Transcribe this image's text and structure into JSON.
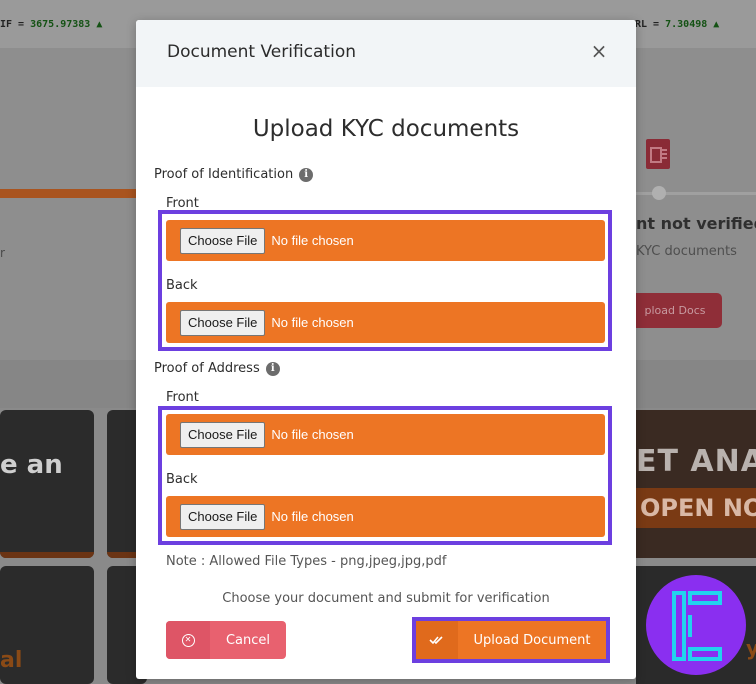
{
  "ticker": [
    {
      "label": "IF = ",
      "value": "3675.97383 ▲"
    },
    {
      "label": "RL = ",
      "value": "7.30498 ▲"
    }
  ],
  "background": {
    "status_title": "nt not verified",
    "status_sub": "KYC documents",
    "upload_docs_label": "pload Docs",
    "left_text": "r",
    "card1_text": "e an",
    "card3_text": "al",
    "banner_line1": "ET ANA",
    "banner_line2": "OPEN NOW",
    "banner2_text": "ys"
  },
  "modal": {
    "title": "Document Verification",
    "close_glyph": "×",
    "heading": "Upload KYC documents",
    "sections": [
      {
        "label": "Proof of Identification",
        "fields": [
          {
            "label": "Front",
            "button": "Choose File",
            "status": "No file chosen"
          },
          {
            "label": "Back",
            "button": "Choose File",
            "status": "No file chosen"
          }
        ]
      },
      {
        "label": "Proof of Address",
        "fields": [
          {
            "label": "Front",
            "button": "Choose File",
            "status": "No file chosen"
          },
          {
            "label": "Back",
            "button": "Choose File",
            "status": "No file chosen"
          }
        ]
      }
    ],
    "info_glyph": "i",
    "note": "Note : Allowed File Types - png,jpeg,jpg,pdf",
    "instruction": "Choose your document and submit for verification",
    "cancel_label": "Cancel",
    "cancel_icon": "close-circle-icon",
    "upload_label": "Upload Document",
    "upload_icon": "double-check-icon"
  },
  "colors": {
    "accent_orange": "#ed7524",
    "highlight_purple": "#6c3fe0",
    "cancel_red": "#e8616f",
    "logo_purple": "#8a2ff0",
    "logo_cyan": "#22d3ee"
  },
  "watermark": {
    "icon": "tradingfinder-logo-icon"
  }
}
